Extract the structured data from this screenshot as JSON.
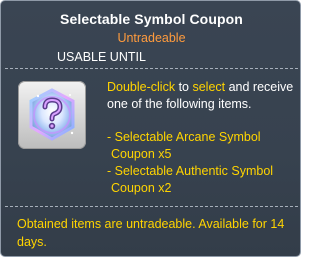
{
  "tooltip": {
    "title": "Selectable Symbol Coupon",
    "trade_status": "Untradeable",
    "usable_until": "USABLE UNTIL",
    "icon": "question-mark-coupon-icon",
    "description": {
      "part1": "Double-click",
      "part2": " to ",
      "part3": "select",
      "part4": " and receive one of the following items."
    },
    "items": [
      {
        "line1": "- Selectable Arcane Symbol",
        "line2": "Coupon x5"
      },
      {
        "line1": "- Selectable Authentic Symbol",
        "line2": "Coupon x2"
      }
    ],
    "footer": "Obtained items are untradeable. Available for 14 days.",
    "colors": {
      "background": "#37424f",
      "title": "#ffffff",
      "untradeable": "#ff9b3d",
      "highlight": "#ffd400"
    }
  }
}
